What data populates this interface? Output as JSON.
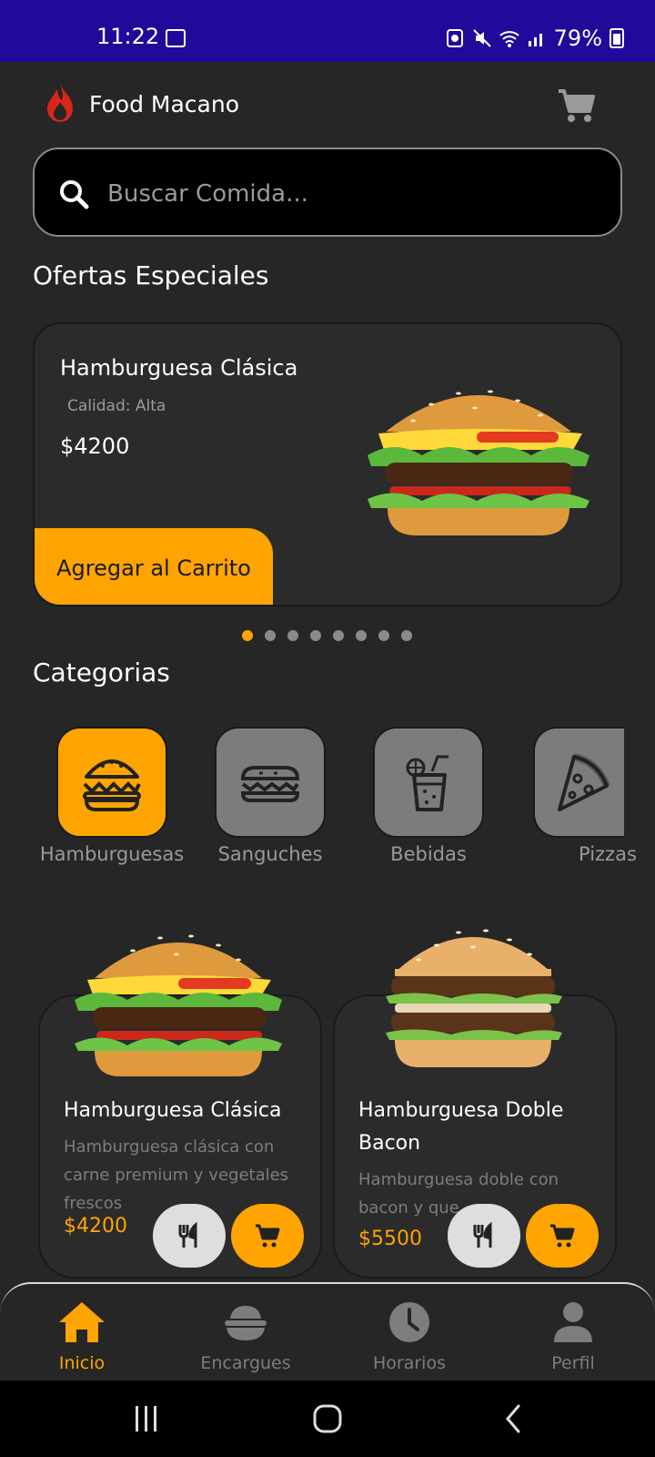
{
  "status_bar": {
    "time": "11:22",
    "battery": "79%"
  },
  "header": {
    "title": "Food Macano",
    "brand_color": "#d9261c",
    "accent_color": "#ffa400"
  },
  "search": {
    "placeholder": "Buscar Comida..."
  },
  "offers": {
    "section_title": "Ofertas Especiales",
    "card": {
      "title": "Hamburguesa Clásica",
      "quality": "Calidad: Alta",
      "price": "$4200",
      "button_label": "Agregar al Carrito"
    },
    "carousel_dot_count": 8,
    "carousel_active_index": 0
  },
  "categories": {
    "section_title": "Categorias",
    "items": [
      {
        "label": "Hamburguesas",
        "icon": "burger-icon",
        "active": true
      },
      {
        "label": "Sanguches",
        "icon": "sandwich-icon",
        "active": false
      },
      {
        "label": "Bebidas",
        "icon": "drink-icon",
        "active": false
      },
      {
        "label": "Pizzas",
        "icon": "pizza-icon",
        "active": false
      }
    ]
  },
  "products": [
    {
      "title": "Hamburguesa Clásica",
      "description": "Hamburguesa clásica con carne premium y vegetales frescos",
      "price": "$4200"
    },
    {
      "title": "Hamburguesa Doble Bacon",
      "description": "Hamburguesa doble con bacon y que",
      "price": "$5500"
    }
  ],
  "bottom_nav": {
    "items": [
      {
        "label": "Inicio",
        "icon": "home-icon",
        "active": true
      },
      {
        "label": "Encargues",
        "icon": "bowl-icon",
        "active": false
      },
      {
        "label": "Horarios",
        "icon": "clock-icon",
        "active": false
      },
      {
        "label": "Perfil",
        "icon": "person-icon",
        "active": false
      }
    ]
  }
}
